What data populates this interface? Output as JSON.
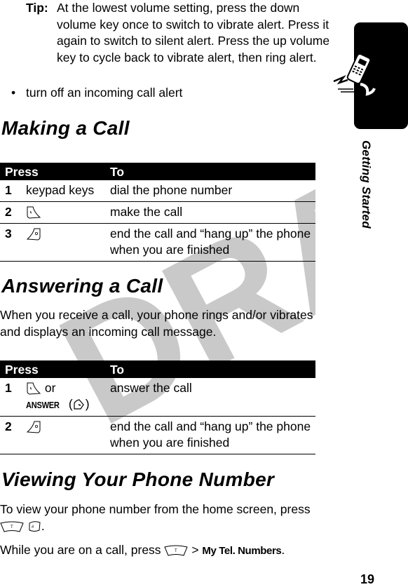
{
  "tip": {
    "label": "Tip:",
    "text": "At the lowest volume setting, press the down volume key once to switch to vibrate alert. Press it again to switch to silent alert. Press the up volume key to cycle back to vibrate alert, then ring alert."
  },
  "bullet": {
    "symbol": "•",
    "text": "turn off an incoming call alert"
  },
  "sections": {
    "making": {
      "heading": "Making a Call",
      "table": {
        "headers": {
          "press": "Press",
          "to": "To"
        },
        "rows": [
          {
            "num": "1",
            "press": "keypad keys",
            "press_icon": "",
            "to": "dial the phone number"
          },
          {
            "num": "2",
            "press": "",
            "press_icon": "send-key-icon",
            "to": "make the call"
          },
          {
            "num": "3",
            "press": "",
            "press_icon": "end-key-icon",
            "to": "end the call and “hang up” the phone when you are finished"
          }
        ]
      }
    },
    "answering": {
      "heading": "Answering a Call",
      "intro": "When you receive a call, your phone rings and/or vibrates and displays an incoming call message.",
      "table": {
        "headers": {
          "press": "Press",
          "to": "To"
        },
        "rows": [
          {
            "num": "1",
            "press_or": "or",
            "softkey_label": "ANSWER",
            "press_icon": "send-key-icon",
            "softkey_icon": "soft-key-icon",
            "to": "answer the call"
          },
          {
            "num": "2",
            "press_icon": "end-key-icon",
            "to": "end the call and “hang up” the phone when you are finished"
          }
        ]
      }
    },
    "viewing": {
      "heading": "Viewing Your Phone Number",
      "para1": "To view your phone number from the home screen, press",
      "para1_end": ".",
      "para2_start": "While you are on a call, press",
      "para2_sep": ">",
      "para2_menu": "My Tel. Numbers",
      "para2_end": "."
    }
  },
  "side_tab": {
    "label": "Getting Started",
    "icon": "running-phone-icon"
  },
  "watermark": "DRAFT",
  "page_number": "19"
}
